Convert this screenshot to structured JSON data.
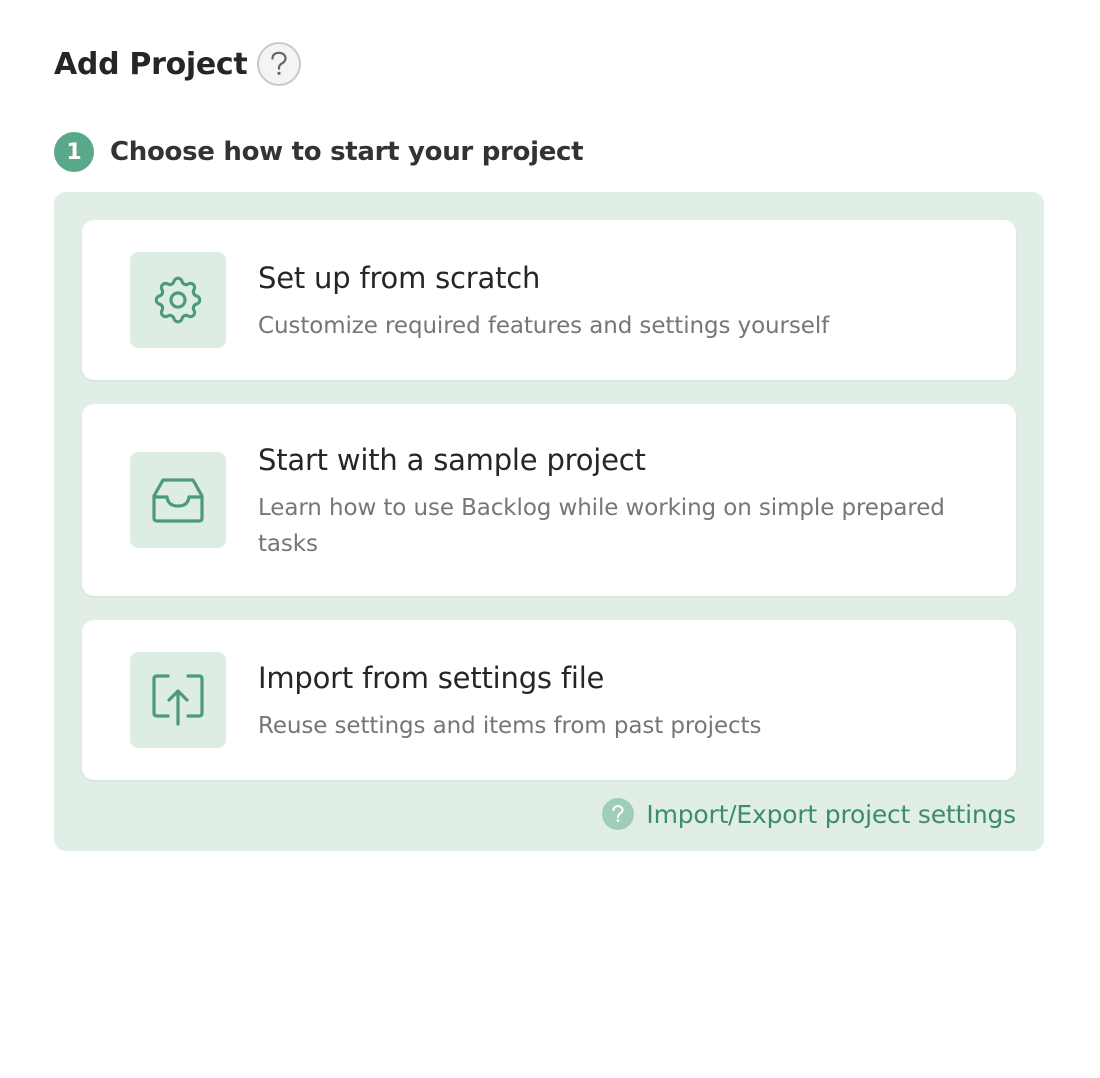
{
  "page": {
    "title": "Add Project",
    "help_icon": "question-mark-icon"
  },
  "step": {
    "number": "1",
    "title": "Choose how to start your project"
  },
  "options": [
    {
      "icon": "gear-icon",
      "title": "Set up from scratch",
      "description": "Customize required features and settings yourself"
    },
    {
      "icon": "inbox-tray-icon",
      "title": "Start with a sample project",
      "description": "Learn how to use Backlog while working on simple prepared tasks"
    },
    {
      "icon": "upload-box-icon",
      "title": "Import from settings file",
      "description": "Reuse settings and items from past projects"
    }
  ],
  "help_link": {
    "icon": "question-mark-icon",
    "label": "Import/Export project settings"
  },
  "colors": {
    "accent": "#5aa88a",
    "accent_dark": "#3d8c6a",
    "panel_background": "#e0eee6",
    "icon_tile_background": "#ddede4",
    "link_icon_background": "#9fcdb8"
  }
}
